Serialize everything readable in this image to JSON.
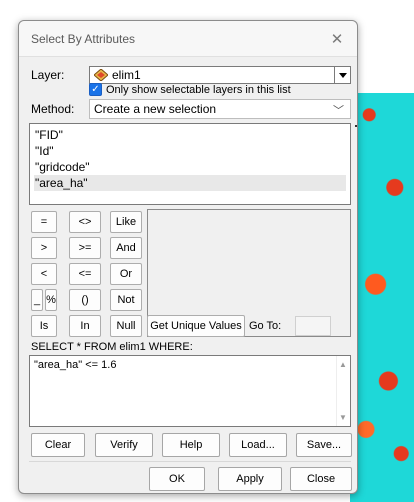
{
  "dialog": {
    "title": "Select By Attributes",
    "layer_label": "Layer:",
    "layer_value": "elim1",
    "only_selectable_label": "Only show selectable layers in this list",
    "method_label": "Method:",
    "method_value": "Create a new selection",
    "fields": [
      "\"FID\"",
      "\"Id\"",
      "\"gridcode\"",
      "\"area_ha\""
    ],
    "selected_field_index": 3,
    "operators": {
      "eq": "=",
      "ne": "<>",
      "like": "Like",
      "gt": ">",
      "ge": ">=",
      "and": "And",
      "lt": "<",
      "le": "<=",
      "or": "Or",
      "underscore": "_",
      "percent": "%",
      "parens": "()",
      "not": "Not",
      "is": "Is",
      "in": "In",
      "null": "Null"
    },
    "get_unique_values": "Get Unique Values",
    "goto_label": "Go To:",
    "sql_prefix": "SELECT * FROM elim1 WHERE:",
    "expression": "\"area_ha\" <= 1.6",
    "buttons": {
      "clear": "Clear",
      "verify": "Verify",
      "help": "Help",
      "load": "Load...",
      "save": "Save...",
      "ok": "OK",
      "apply": "Apply",
      "close": "Close"
    }
  },
  "colors": {
    "map_cyan": "#1ed8d8",
    "map_red": "#e53a1e",
    "checkbox_blue": "#1a73e8"
  }
}
